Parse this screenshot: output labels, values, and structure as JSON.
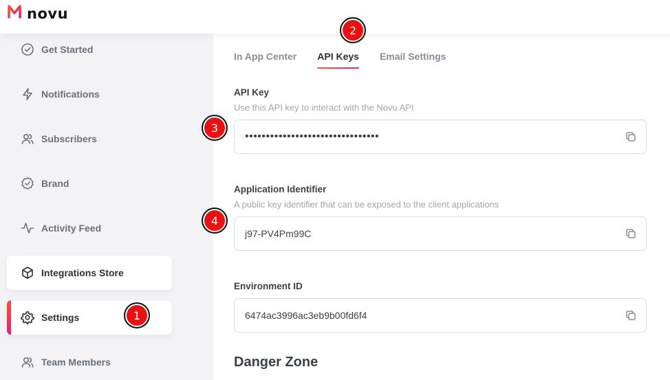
{
  "brand": {
    "name": "novu"
  },
  "sidebar": {
    "items": [
      {
        "label": "Get Started",
        "icon": "check-circle-icon"
      },
      {
        "label": "Notifications",
        "icon": "bolt-icon"
      },
      {
        "label": "Subscribers",
        "icon": "users-icon"
      },
      {
        "label": "Brand",
        "icon": "badge-check-icon"
      },
      {
        "label": "Activity Feed",
        "icon": "activity-icon"
      },
      {
        "label": "Integrations Store",
        "icon": "box-icon"
      },
      {
        "label": "Settings",
        "icon": "gear-icon",
        "active": true
      },
      {
        "label": "Team Members",
        "icon": "users-icon"
      }
    ]
  },
  "tabs": [
    {
      "label": "In App Center"
    },
    {
      "label": "API Keys",
      "active": true
    },
    {
      "label": "Email Settings"
    }
  ],
  "api_key": {
    "label": "API Key",
    "description": "Use this API key to interact with the Novu API",
    "value": "••••••••••••••••••••••••••••••••"
  },
  "app_identifier": {
    "label": "Application Identifier",
    "description": "A public key identifier that can be exposed to the client applications",
    "value": "j97-PV4Pm99C"
  },
  "environment_id": {
    "label": "Environment ID",
    "value": "6474ac3996ac3eb9b00fd6f4"
  },
  "danger_zone": {
    "title": "Danger Zone"
  },
  "markers": [
    "1",
    "2",
    "3",
    "4"
  ],
  "colors": {
    "accent_start": "#ff512f",
    "accent_end": "#dd2476",
    "marker": "#e81010"
  }
}
